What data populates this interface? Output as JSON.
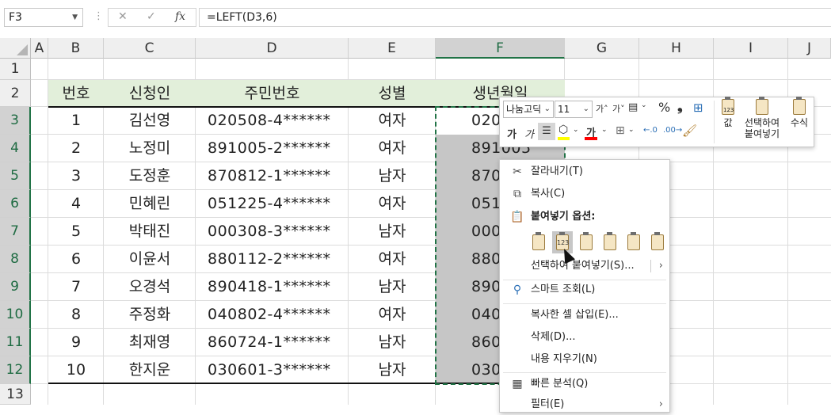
{
  "formula_bar": {
    "name_box": "F3",
    "cancel_icon": "✕",
    "enter_icon": "✓",
    "fx_icon": "fx",
    "formula": "=LEFT(D3,6)"
  },
  "columns": [
    "A",
    "B",
    "C",
    "D",
    "E",
    "F",
    "G",
    "H",
    "I",
    "J"
  ],
  "rows": [
    "1",
    "2",
    "3",
    "4",
    "5",
    "6",
    "7",
    "8",
    "9",
    "10",
    "11",
    "12",
    "13"
  ],
  "table": {
    "headers": [
      "번호",
      "신청인",
      "주민번호",
      "성별",
      "생년월일"
    ],
    "rows": [
      [
        "1",
        "김선영",
        "020508-4******",
        "여자",
        "020"
      ],
      [
        "2",
        "노정미",
        "891005-2******",
        "여자",
        "891005"
      ],
      [
        "3",
        "도정훈",
        "870812-1******",
        "남자",
        "870"
      ],
      [
        "4",
        "민혜린",
        "051225-4******",
        "여자",
        "051"
      ],
      [
        "5",
        "박태진",
        "000308-3******",
        "남자",
        "000"
      ],
      [
        "6",
        "이윤서",
        "880112-2******",
        "여자",
        "880"
      ],
      [
        "7",
        "오경석",
        "890418-1******",
        "남자",
        "890"
      ],
      [
        "8",
        "주정화",
        "040802-4******",
        "여자",
        "040"
      ],
      [
        "9",
        "최재영",
        "860724-1******",
        "남자",
        "860"
      ],
      [
        "10",
        "한지운",
        "030601-3******",
        "남자",
        "030"
      ]
    ]
  },
  "mini_toolbar": {
    "font": "나눔고딕",
    "size": "11",
    "grow": "가˄",
    "shrink": "가˅",
    "percent": "%",
    "comma": "❟",
    "bold": "가",
    "italic": "가",
    "font_color_letter": "가",
    "paste_values": {
      "label": "값",
      "sub": "123"
    },
    "paste_special": "선택하여\n붙여넣기",
    "paste_formula": "수식",
    "colors": {
      "fill": "#ffff00",
      "font": "#ff0000",
      "accent": "#217346"
    }
  },
  "context_menu": {
    "cut": "잘라내기(T)",
    "copy": "복사(C)",
    "paste_options": "붙여넣기 옵션:",
    "paste_special": "선택하여 붙여넣기(S)...",
    "smart_lookup": "스마트 조회(L)",
    "insert_copied": "복사한 셀 삽입(E)...",
    "delete": "삭제(D)...",
    "clear": "내용 지우기(N)",
    "quick_analysis": "빠른 분석(Q)",
    "filter": "필터(E)",
    "submenu_arrow": "›",
    "paste_icon_123": "123"
  }
}
